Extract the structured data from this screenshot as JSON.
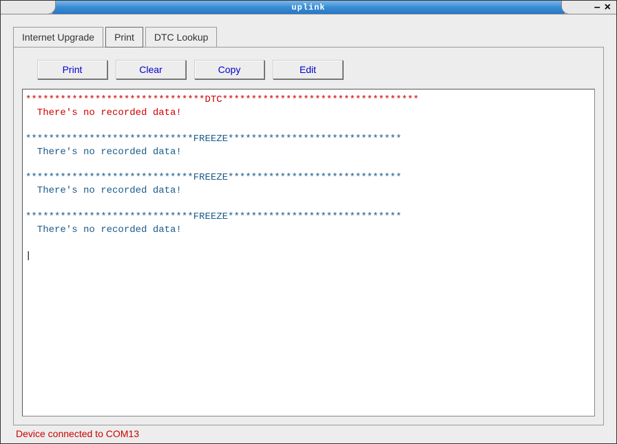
{
  "window": {
    "title": "uplink",
    "minimize": "–",
    "close": "×"
  },
  "tabs": {
    "upgrade": "Internet Upgrade",
    "print": "Print",
    "lookup": "DTC Lookup"
  },
  "buttons": {
    "print": "Print",
    "clear": "Clear",
    "copy": "Copy",
    "edit": "Edit"
  },
  "content": {
    "dtc_header": "*******************************DTC**********************************",
    "dtc_body": "  There's no recorded data!",
    "freeze_header_1": "*****************************FREEZE******************************",
    "freeze_body_1": "  There's no recorded data!",
    "freeze_header_2": "*****************************FREEZE******************************",
    "freeze_body_2": "  There's no recorded data!",
    "freeze_header_3": "*****************************FREEZE******************************",
    "freeze_body_3": "  There's no recorded data!"
  },
  "status": "Device connected to COM13"
}
